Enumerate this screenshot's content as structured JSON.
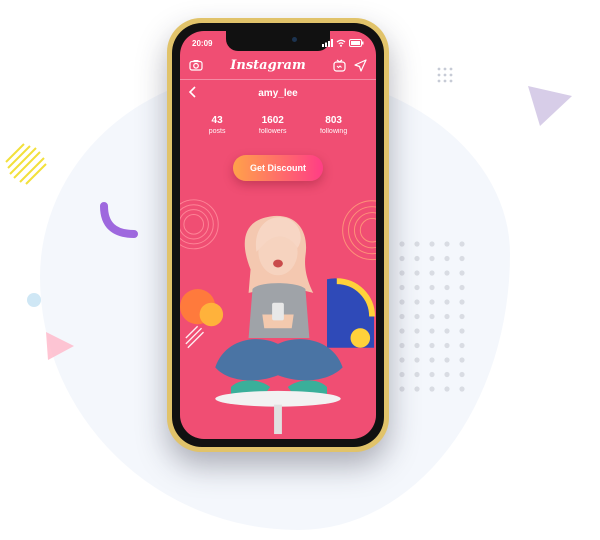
{
  "status_bar": {
    "time": "20:09"
  },
  "header": {
    "app_title": "Instagram"
  },
  "profile": {
    "username": "amy_lee"
  },
  "stats": [
    {
      "value": "43",
      "label": "posts"
    },
    {
      "value": "1602",
      "label": "followers"
    },
    {
      "value": "803",
      "label": "following"
    }
  ],
  "cta": {
    "label": "Get Discount"
  },
  "colors": {
    "screen_bg": "#f04e73",
    "phone_frame": "#e1c36a",
    "cta_start": "#ffa24a",
    "cta_end": "#ff3d86",
    "deco_purple": "#8e4fd8",
    "deco_yellow": "#f2e03c",
    "deco_lavender": "#d7cde8",
    "deco_pink": "#ffb6c8"
  },
  "icons": [
    "camera-icon",
    "igtv-icon",
    "send-icon",
    "back-arrow-icon",
    "signal-icon",
    "wifi-icon",
    "battery-icon"
  ]
}
